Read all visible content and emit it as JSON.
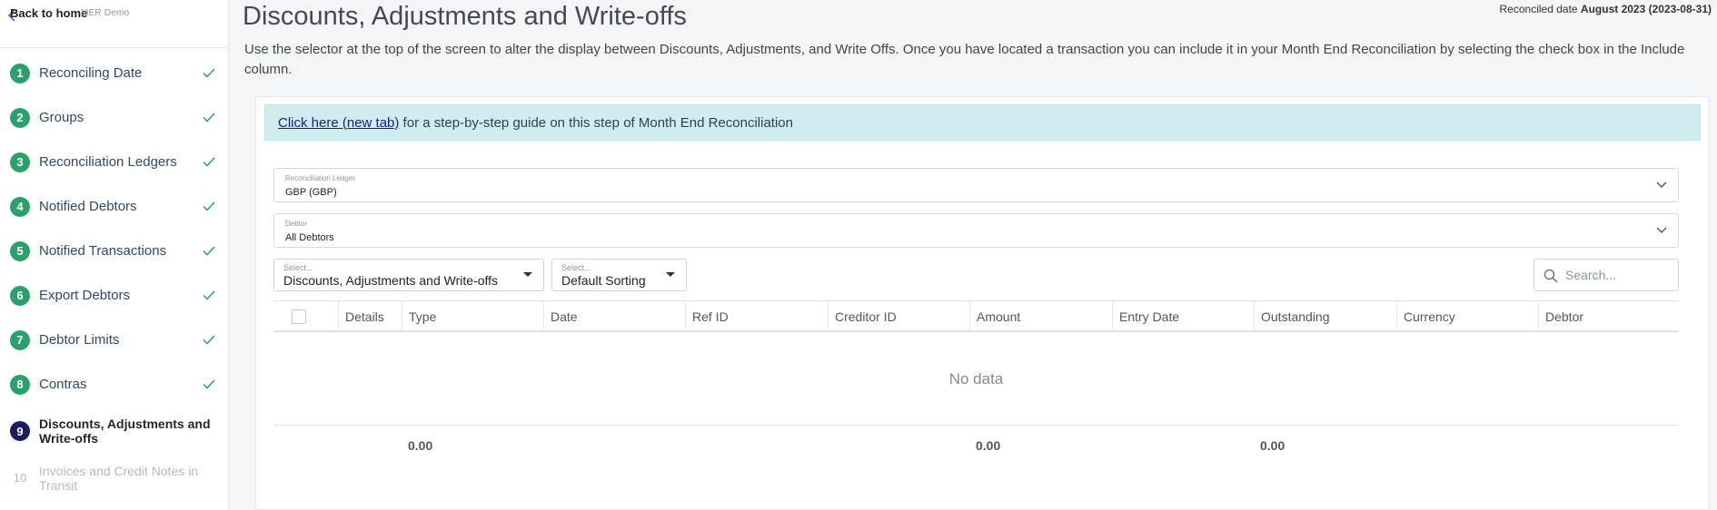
{
  "sidebar": {
    "back_label": "Back to home",
    "org_label": "MER Demo",
    "steps": [
      {
        "num": "1",
        "label": "Reconciling Date",
        "status": "done"
      },
      {
        "num": "2",
        "label": "Groups",
        "status": "done"
      },
      {
        "num": "3",
        "label": "Reconciliation Ledgers",
        "status": "done"
      },
      {
        "num": "4",
        "label": "Notified Debtors",
        "status": "done"
      },
      {
        "num": "5",
        "label": "Notified Transactions",
        "status": "done"
      },
      {
        "num": "6",
        "label": "Export Debtors",
        "status": "done"
      },
      {
        "num": "7",
        "label": "Debtor Limits",
        "status": "done"
      },
      {
        "num": "8",
        "label": "Contras",
        "status": "done"
      },
      {
        "num": "9",
        "label": "Discounts, Adjustments and Write-offs",
        "status": "active"
      },
      {
        "num": "10",
        "label": "Invoices and Credit Notes in Transit",
        "status": "pending"
      }
    ]
  },
  "header": {
    "title": "Discounts, Adjustments and Write-offs",
    "reconciled_prefix": "Reconciled date",
    "reconciled_value": "August 2023 (2023-08-31)",
    "intro": "Use the selector at the top of the screen to alter the display between Discounts, Adjustments, and Write Offs. Once you have located a transaction you can include it in your Month End Reconciliation by selecting the check box in the Include column."
  },
  "guide": {
    "link_text": "Click here (new tab)",
    "rest_text": " for a step-by-step guide on this step of Month End Reconciliation"
  },
  "filters": {
    "ledger": {
      "label": "Reconciliation Ledger",
      "value": "GBP (GBP)"
    },
    "debtor": {
      "label": "Debtor",
      "value": "All Debtors"
    },
    "type_select": {
      "label": "Select...",
      "value": "Discounts, Adjustments and Write-offs"
    },
    "sort_select": {
      "label": "Select...",
      "value": "Default Sorting"
    },
    "search_placeholder": "Search..."
  },
  "table": {
    "columns": [
      "Details",
      "Type",
      "Date",
      "Ref ID",
      "Creditor ID",
      "Amount",
      "Entry Date",
      "Outstanding",
      "Currency",
      "Debtor"
    ],
    "empty_text": "No data",
    "totals": {
      "type": "0.00",
      "amount": "0.00",
      "outstanding": "0.00"
    }
  },
  "colors": {
    "step_done": "#28a26a",
    "step_active": "#1b1d5c",
    "guide_bg": "#d1ecf1"
  }
}
